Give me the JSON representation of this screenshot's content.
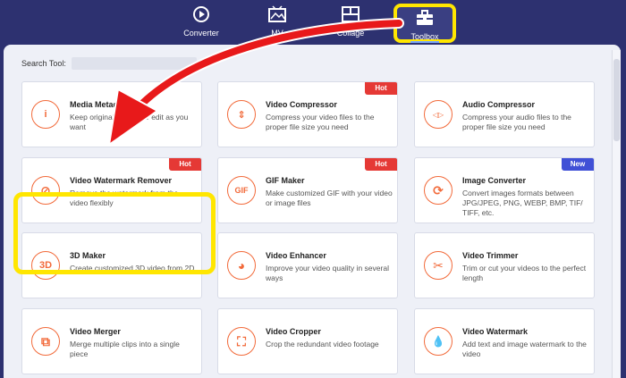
{
  "nav": {
    "items": [
      {
        "label": "Converter",
        "icon": "converter-icon"
      },
      {
        "label": "MV",
        "icon": "mv-icon"
      },
      {
        "label": "Collage",
        "icon": "collage-icon"
      },
      {
        "label": "Toolbox",
        "icon": "toolbox-icon"
      }
    ],
    "active": "Toolbox"
  },
  "search": {
    "label": "Search Tool:",
    "placeholder": ""
  },
  "tools": [
    {
      "title": "Media Metadata",
      "desc": "Keep original file info or edit as you want",
      "badge": "",
      "icon": "info-icon",
      "glyph": "i"
    },
    {
      "title": "Video Compressor",
      "desc": "Compress your video files to the proper file size you need",
      "badge": "Hot",
      "icon": "compress-icon",
      "glyph": "⇕"
    },
    {
      "title": "Audio Compressor",
      "desc": "Compress your audio files to the proper file size you need",
      "badge": "",
      "icon": "audio-compress-icon",
      "glyph": "◁▷"
    },
    {
      "title": "Video Watermark Remover",
      "desc": "Remove the watermark from the video flexibly",
      "badge": "Hot",
      "icon": "watermark-remove-icon",
      "glyph": "⊘"
    },
    {
      "title": "GIF Maker",
      "desc": "Make customized GIF with your video or image files",
      "badge": "Hot",
      "icon": "gif-icon",
      "glyph": "GIF"
    },
    {
      "title": "Image Converter",
      "desc": "Convert images formats between JPG/JPEG, PNG, WEBP, BMP, TIF/ TIFF, etc.",
      "badge": "New",
      "icon": "image-convert-icon",
      "glyph": "⟳"
    },
    {
      "title": "3D Maker",
      "desc": "Create customized 3D video from 2D",
      "badge": "",
      "icon": "3d-icon",
      "glyph": "3D"
    },
    {
      "title": "Video Enhancer",
      "desc": "Improve your video quality in several ways",
      "badge": "",
      "icon": "palette-icon",
      "glyph": "◕"
    },
    {
      "title": "Video Trimmer",
      "desc": "Trim or cut your videos to the perfect length",
      "badge": "",
      "icon": "scissors-icon",
      "glyph": "✂"
    },
    {
      "title": "Video Merger",
      "desc": "Merge multiple clips into a single piece",
      "badge": "",
      "icon": "merge-icon",
      "glyph": "⧉"
    },
    {
      "title": "Video Cropper",
      "desc": "Crop the redundant video footage",
      "badge": "",
      "icon": "crop-icon",
      "glyph": "⛶"
    },
    {
      "title": "Video Watermark",
      "desc": "Add text and image watermark to the video",
      "badge": "",
      "icon": "droplet-icon",
      "glyph": "💧"
    }
  ],
  "colors": {
    "nav_bg": "#2d3170",
    "accent": "#f26a3a",
    "hot": "#e53935",
    "new": "#4050d6",
    "highlight": "#ffe600",
    "arrow": "#e8191a"
  }
}
